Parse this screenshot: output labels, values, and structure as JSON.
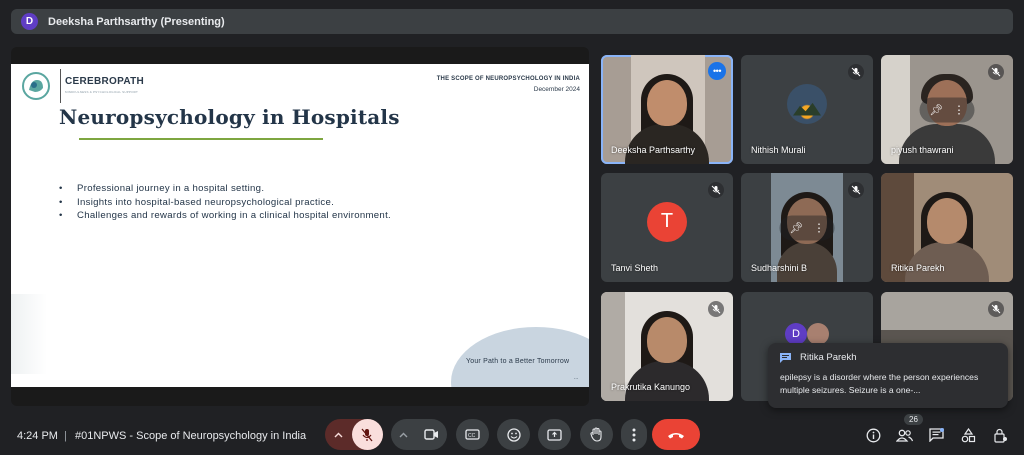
{
  "presenter_bar": {
    "initial": "D",
    "label": "Deeksha Parthsarthy (Presenting)"
  },
  "slide": {
    "brand": "CEREBROPATH",
    "brand_sub": "MINDFULNESS & PSYCHOLOGICAL SUPPORT",
    "header_title": "THE SCOPE OF NEUROPSYCHOLOGY IN INDIA",
    "header_date": "December 2024",
    "title": "Neuropsychology in Hospitals",
    "bullets": [
      "Professional journey in a hospital setting.",
      "Insights into hospital-based neuropsychological practice.",
      "Challenges and rewards of working in a clinical hospital environment."
    ],
    "footer_text": "Your Path to a Better Tomorrow",
    "footer_dots": "..."
  },
  "participants": [
    {
      "name": "Deeksha Parthsarthy",
      "type": "video",
      "muted": false,
      "active": true
    },
    {
      "name": "Nithish Murali",
      "type": "avatar-image",
      "muted": true
    },
    {
      "name": "piyush thawrani",
      "type": "video",
      "muted": true
    },
    {
      "name": "Tanvi Sheth",
      "type": "avatar",
      "initial": "T",
      "muted": true
    },
    {
      "name": "Sudharshini B",
      "type": "video",
      "muted": true
    },
    {
      "name": "Ritika Parekh",
      "type": "video",
      "muted": false
    },
    {
      "name": "Prakrutika Kanungo",
      "type": "video",
      "muted": true
    },
    {
      "name": "",
      "type": "group",
      "initial": "D",
      "muted": false
    },
    {
      "name": "",
      "type": "video",
      "muted": true
    }
  ],
  "chat_toast": {
    "sender": "Ritika Parekh",
    "message": "epilepsy is a disorder where the person experiences multiple seizures. Seizure is a one-..."
  },
  "toolbar": {
    "time": "4:24 PM",
    "separator": "|",
    "meeting_title": "#01NPWS - Scope of Neuropsychology in India",
    "people_count": "26"
  },
  "colors": {
    "accent": "#8ab4f8",
    "end_call": "#ea4335",
    "mic_off": "#f9dedc",
    "brand_green": "#7ea640"
  }
}
